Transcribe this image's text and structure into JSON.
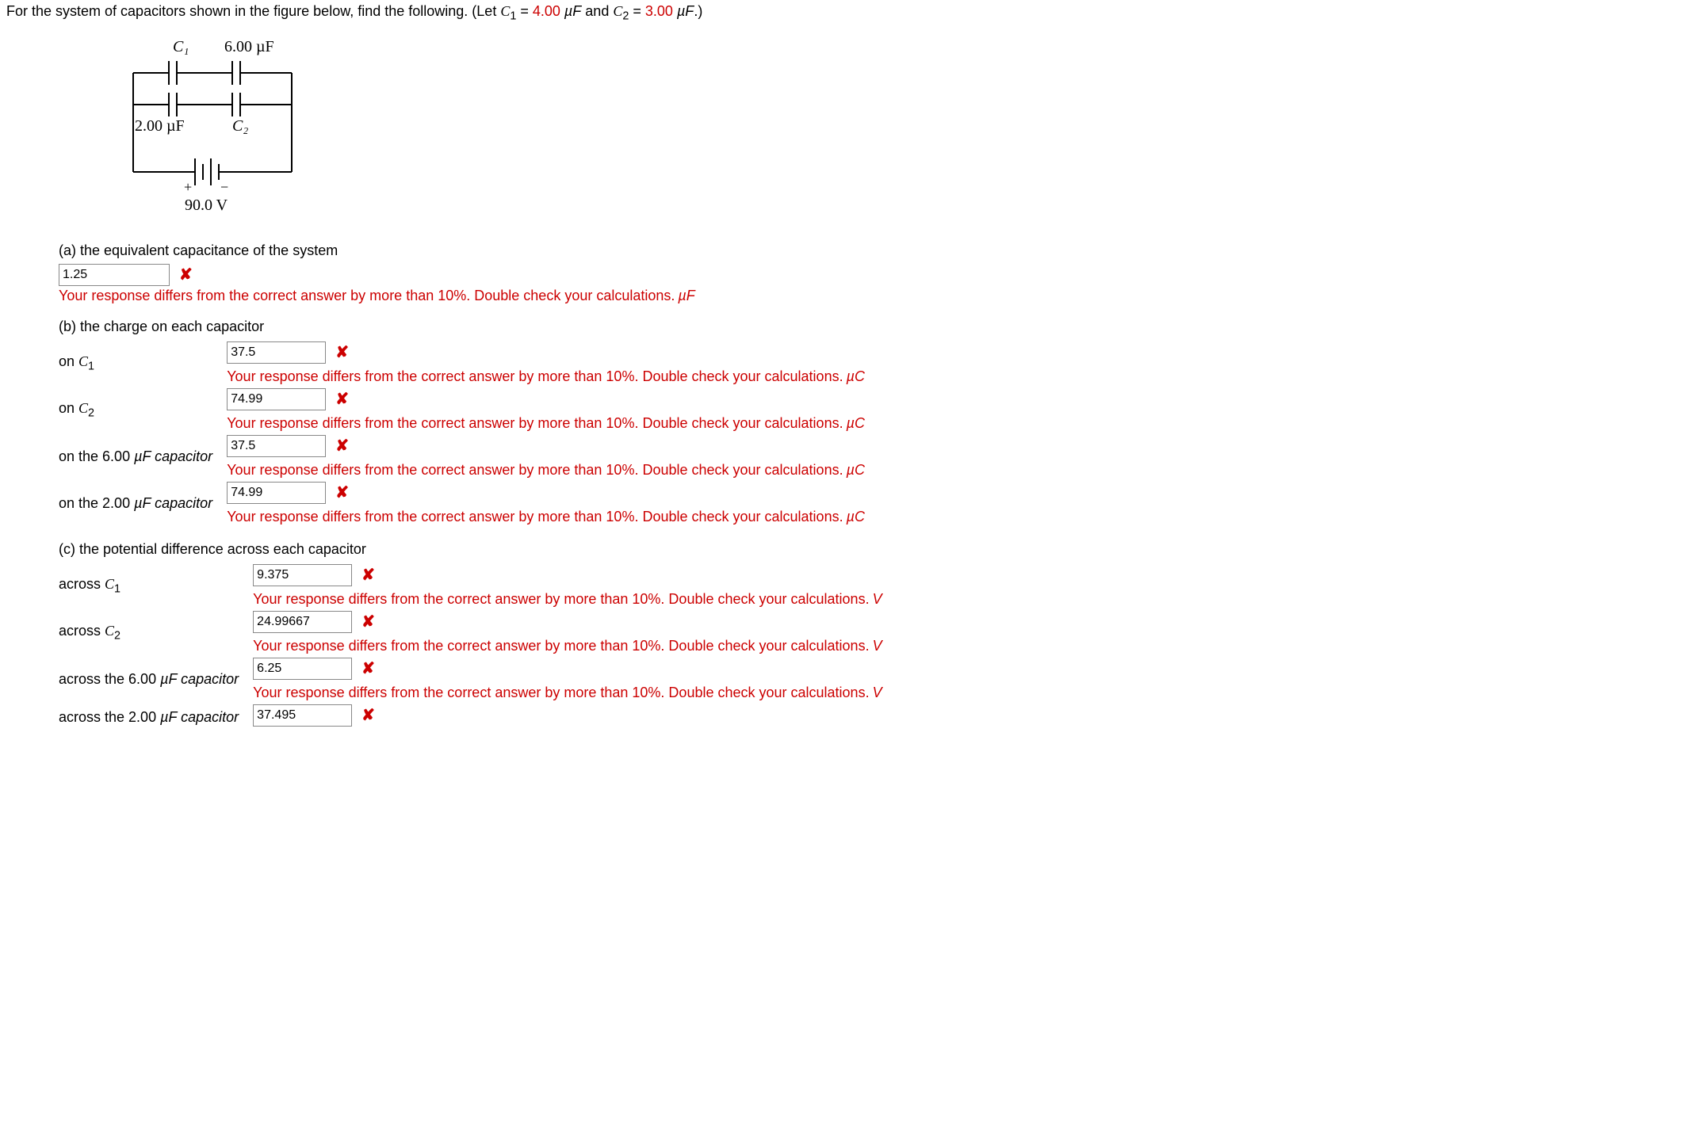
{
  "prompt": {
    "pre": "For the system of capacitors shown in the figure below, find the following. (Let  ",
    "c1_sym": "C",
    "c1_sub": "1",
    "eq1": " = ",
    "c1_val": "4.00",
    "unit1": " µF",
    "mid": "  and  ",
    "c2_sym": "C",
    "c2_sub": "2",
    "eq2": " = ",
    "c2_val": "3.00",
    "unit2": " µF",
    "post": ".)"
  },
  "figure": {
    "c1_label": "C₁",
    "c6_label": "6.00 µF",
    "c2uF_label": "2.00 µF",
    "c2_label": "C₂",
    "bat_plus": "+",
    "bat_minus": "−",
    "bat_v": "90.0 V"
  },
  "partA": {
    "label": "(a) the equivalent capacitance of the system",
    "value": "1.25",
    "feedback": "Your response differs from the correct answer by more than 10%. Double check your calculations.",
    "unit": "µF"
  },
  "partB": {
    "label": "(b) the charge on each capacitor",
    "rows": [
      {
        "lbl_pre": "on ",
        "sym": "C",
        "sub": "1",
        "lbl_post": "",
        "val": "37.5",
        "fb": "Your response differs from the correct answer by more than 10%. Double check your calculations.",
        "unit": "µC"
      },
      {
        "lbl_pre": "on ",
        "sym": "C",
        "sub": "2",
        "lbl_post": "",
        "val": "74.99",
        "fb": "Your response differs from the correct answer by more than 10%. Double check your calculations.",
        "unit": "µC"
      },
      {
        "lbl_pre": "on the 6.00 ",
        "sym": "",
        "sub": "",
        "lbl_post": "µF capacitor",
        "val": "37.5",
        "fb": "Your response differs from the correct answer by more than 10%. Double check your calculations.",
        "unit": "µC"
      },
      {
        "lbl_pre": "on the 2.00 ",
        "sym": "",
        "sub": "",
        "lbl_post": "µF capacitor",
        "val": "74.99",
        "fb": "Your response differs from the correct answer by more than 10%. Double check your calculations.",
        "unit": "µC"
      }
    ]
  },
  "partC": {
    "label": "(c) the potential difference across each capacitor",
    "rows": [
      {
        "lbl_pre": "across ",
        "sym": "C",
        "sub": "1",
        "lbl_post": "",
        "val": "9.375",
        "fb": "Your response differs from the correct answer by more than 10%. Double check your calculations.",
        "unit": "V"
      },
      {
        "lbl_pre": "across ",
        "sym": "C",
        "sub": "2",
        "lbl_post": "",
        "val": "24.99667",
        "fb": "Your response differs from the correct answer by more than 10%. Double check your calculations.",
        "unit": "V"
      },
      {
        "lbl_pre": "across the 6.00 ",
        "sym": "",
        "sub": "",
        "lbl_post": "µF capacitor",
        "val": "6.25",
        "fb": "Your response differs from the correct answer by more than 10%. Double check your calculations.",
        "unit": "V"
      },
      {
        "lbl_pre": "across the 2.00 ",
        "sym": "",
        "sub": "",
        "lbl_post": "µF capacitor",
        "val": "37.495",
        "fb": "",
        "unit": ""
      }
    ]
  }
}
